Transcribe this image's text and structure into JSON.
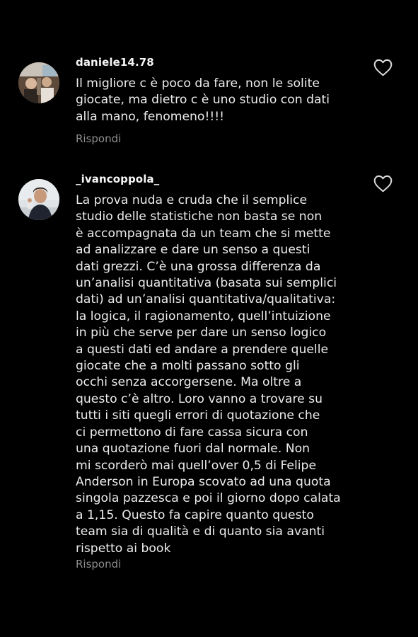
{
  "comments": [
    {
      "username": "daniele14.78",
      "username_extra": "·",
      "text": "Il migliore c è poco da fare, non le solite\ngiocate, ma dietro c è uno studio con dati\nalla mano, fenomeno!!!!",
      "reply_label": "Rispondi",
      "avatar_icon": "avatar-photo",
      "like_icon": "heart-outline-icon"
    },
    {
      "username": "_ivancoppola_",
      "text": "La prova nuda e cruda che il semplice\nstudio delle statistiche non basta se non\nè accompagnata da un team che si mette\nad analizzare e dare un senso a questi\ndati grezzi. C’è una grossa differenza da\nun’analisi quantitativa (basata sui semplici\ndati) ad un’analisi quantitativa/qualitativa:\nla logica, il ragionamento, quell’intuizione\nin più che serve per dare un senso logico\na questi dati ed andare a prendere quelle\ngiocate che a molti passano sotto gli\nocchi senza accorgersene. Ma oltre a\nquesto c’è altro. Loro vanno a trovare su\ntutti i siti quegli errori di quotazione che\nci permettono di fare cassa sicura con\nuna quotazione fuori dal normale. Non\nmi scorderò mai quell’over 0,5 di Felipe\nAnderson in Europa scovato ad una quota\nsingola pazzesca e poi il giorno dopo calata\na 1,15. Questo fa capire quanto questo\nteam sia di qualità e di quanto sia avanti\nrispetto ai book",
      "reply_label": "Rispondi",
      "avatar_icon": "avatar-photo",
      "like_icon": "heart-outline-icon"
    }
  ],
  "colors": {
    "background": "#000000",
    "text": "#ececec",
    "secondary": "#8e8e8e"
  }
}
